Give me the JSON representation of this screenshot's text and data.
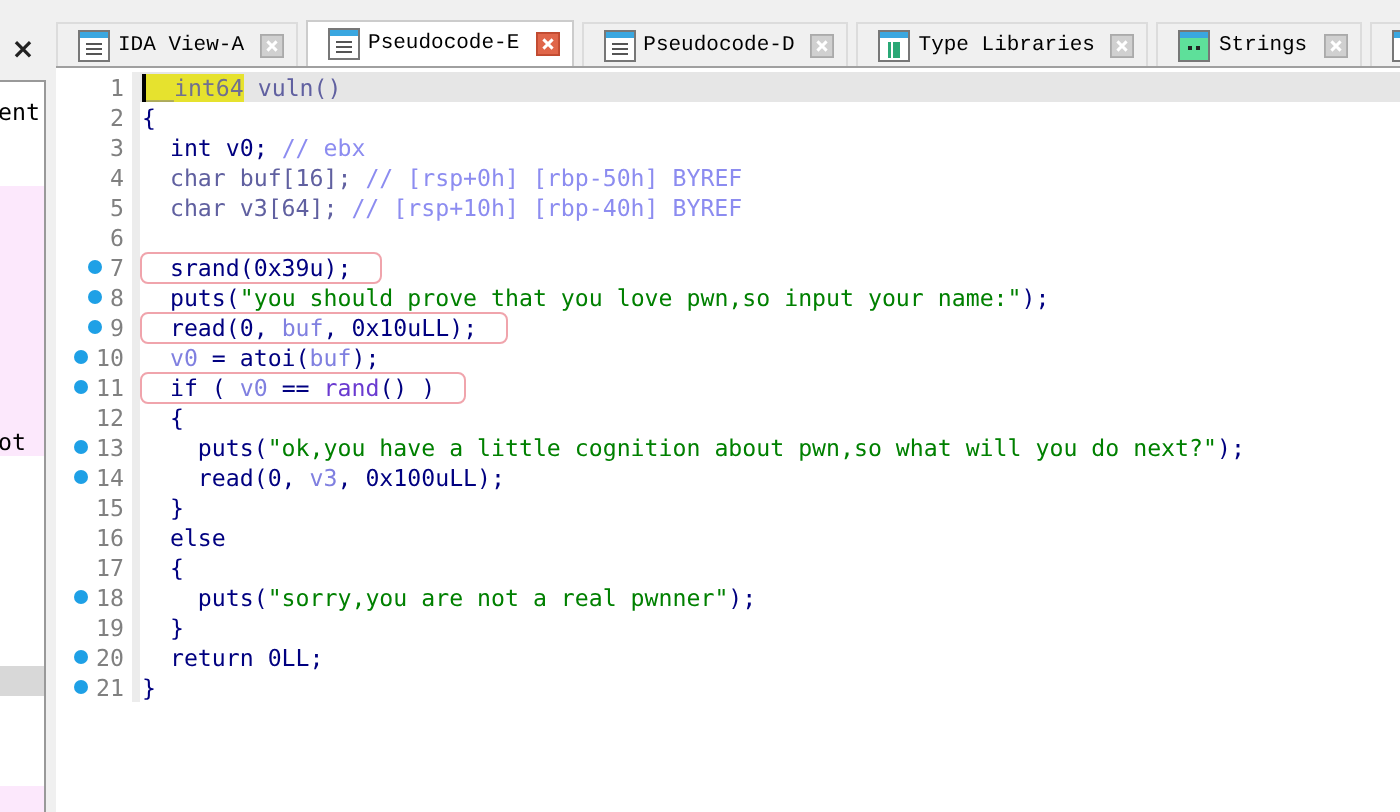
{
  "side_panel": {
    "close": "×",
    "rows": [
      {
        "kind": "row",
        "label": "ent",
        "marked": false,
        "selected": false
      },
      {
        "kind": "blank"
      },
      {
        "kind": "blank"
      },
      {
        "kind": "row",
        "marked": true,
        "selected": false
      },
      {
        "kind": "row",
        "marked": true,
        "selected": false
      },
      {
        "kind": "row",
        "marked": true,
        "selected": false
      },
      {
        "kind": "row",
        "marked": true,
        "selected": false
      },
      {
        "kind": "row",
        "marked": true,
        "selected": false
      },
      {
        "kind": "row",
        "marked": true,
        "selected": false
      },
      {
        "kind": "row",
        "marked": true,
        "selected": false
      },
      {
        "kind": "row",
        "marked": true,
        "selected": false
      },
      {
        "kind": "row",
        "label": "ot",
        "marked": true,
        "selected": false
      },
      {
        "kind": "blank"
      },
      {
        "kind": "blank"
      },
      {
        "kind": "blank"
      },
      {
        "kind": "blank"
      },
      {
        "kind": "blank"
      },
      {
        "kind": "blank"
      },
      {
        "kind": "blank"
      },
      {
        "kind": "row",
        "marked": false,
        "selected": true
      },
      {
        "kind": "blank"
      },
      {
        "kind": "blank"
      },
      {
        "kind": "blank"
      },
      {
        "kind": "row",
        "marked": true,
        "selected": false
      }
    ]
  },
  "tabs": [
    {
      "label": "IDA View-A",
      "kind": "listing",
      "selected": false
    },
    {
      "label": "Pseudocode-E",
      "kind": "listing",
      "selected": true
    },
    {
      "label": "Pseudocode-D",
      "kind": "listing",
      "selected": false
    },
    {
      "label": "Type Libraries",
      "kind": "types",
      "selected": false
    },
    {
      "label": "Strings",
      "kind": "strings",
      "selected": false
    },
    {
      "kind": "listing",
      "selected": false
    }
  ],
  "code_lines": [
    {
      "number": "1",
      "breakpoint": false,
      "current": true,
      "boxed": false,
      "tokens": [
        {
          "kind": "cursor",
          "text": "__int64"
        },
        {
          "kind": "dim",
          "text": " vuln()"
        }
      ]
    },
    {
      "number": "2",
      "breakpoint": false,
      "current": false,
      "boxed": false,
      "tokens": [
        {
          "kind": "code",
          "text": "{"
        }
      ]
    },
    {
      "number": "3",
      "breakpoint": false,
      "current": false,
      "boxed": false,
      "tokens": [
        {
          "kind": "code",
          "text": "  int v0; "
        },
        {
          "kind": "comment",
          "text": "// ebx"
        }
      ]
    },
    {
      "number": "4",
      "breakpoint": false,
      "current": false,
      "boxed": false,
      "tokens": [
        {
          "kind": "dim",
          "text": "  char buf[16]; "
        },
        {
          "kind": "comment",
          "text": "// [rsp+0h] [rbp-50h] BYREF"
        }
      ]
    },
    {
      "number": "5",
      "breakpoint": false,
      "current": false,
      "boxed": false,
      "tokens": [
        {
          "kind": "dim",
          "text": "  char v3[64]; "
        },
        {
          "kind": "comment",
          "text": "// [rsp+10h] [rbp-40h] BYREF"
        }
      ]
    },
    {
      "number": "6",
      "breakpoint": false
    },
    {
      "number": "7",
      "breakpoint": true,
      "current": false,
      "boxed": true,
      "tokens": [
        {
          "kind": "code",
          "text": "  srand(0x39u);"
        }
      ]
    },
    {
      "number": "8",
      "breakpoint": true,
      "current": false,
      "boxed": false,
      "tokens": [
        {
          "kind": "code",
          "text": "  puts("
        },
        {
          "kind": "string",
          "text": "\"you should prove that you love pwn,so input your name:\""
        },
        {
          "kind": "code",
          "text": ");"
        }
      ]
    },
    {
      "number": "9",
      "breakpoint": true,
      "current": false,
      "boxed": true,
      "tokens": [
        {
          "kind": "code",
          "text": "  read(0, "
        },
        {
          "kind": "var",
          "text": "buf"
        },
        {
          "kind": "code",
          "text": ", 0x10uLL);"
        }
      ]
    },
    {
      "number": "10",
      "breakpoint": true,
      "current": false,
      "boxed": false,
      "tokens": [
        {
          "kind": "var",
          "text": "  v0"
        },
        {
          "kind": "code",
          "text": " = atoi("
        },
        {
          "kind": "var",
          "text": "buf"
        },
        {
          "kind": "code",
          "text": ");"
        }
      ]
    },
    {
      "number": "11",
      "breakpoint": true,
      "current": false,
      "boxed": true,
      "tokens": [
        {
          "kind": "code",
          "text": "  if ( "
        },
        {
          "kind": "var",
          "text": "v0"
        },
        {
          "kind": "code",
          "text": " == "
        },
        {
          "kind": "call",
          "text": "rand"
        },
        {
          "kind": "code",
          "text": "() )"
        }
      ]
    },
    {
      "number": "12",
      "breakpoint": false,
      "current": false,
      "boxed": false,
      "tokens": [
        {
          "kind": "code",
          "text": "  {"
        }
      ]
    },
    {
      "number": "13",
      "breakpoint": true,
      "current": false,
      "boxed": false,
      "tokens": [
        {
          "kind": "code",
          "text": "    puts("
        },
        {
          "kind": "string",
          "text": "\"ok,you have a little cognition about pwn,so what will you do next?\""
        },
        {
          "kind": "code",
          "text": ");"
        }
      ]
    },
    {
      "number": "14",
      "breakpoint": true,
      "current": false,
      "boxed": false,
      "tokens": [
        {
          "kind": "code",
          "text": "    read(0, "
        },
        {
          "kind": "var",
          "text": "v3"
        },
        {
          "kind": "code",
          "text": ", 0x100uLL);"
        }
      ]
    },
    {
      "number": "15",
      "breakpoint": false,
      "current": false,
      "boxed": false,
      "tokens": [
        {
          "kind": "code",
          "text": "  }"
        }
      ]
    },
    {
      "number": "16",
      "breakpoint": false,
      "current": false,
      "boxed": false,
      "tokens": [
        {
          "kind": "code",
          "text": "  else"
        }
      ]
    },
    {
      "number": "17",
      "breakpoint": false,
      "current": false,
      "boxed": false,
      "tokens": [
        {
          "kind": "code",
          "text": "  {"
        }
      ]
    },
    {
      "number": "18",
      "breakpoint": true,
      "current": false,
      "boxed": false,
      "tokens": [
        {
          "kind": "code",
          "text": "    puts("
        },
        {
          "kind": "string",
          "text": "\"sorry,you are not a real pwnner\""
        },
        {
          "kind": "code",
          "text": ");"
        }
      ]
    },
    {
      "number": "19",
      "breakpoint": false,
      "current": false,
      "boxed": false,
      "tokens": [
        {
          "kind": "code",
          "text": "  }"
        }
      ]
    },
    {
      "number": "20",
      "breakpoint": true,
      "current": false,
      "boxed": false,
      "tokens": [
        {
          "kind": "code",
          "text": "  return 0LL;"
        }
      ]
    },
    {
      "number": "21",
      "breakpoint": true,
      "current": false,
      "boxed": false,
      "tokens": [
        {
          "kind": "code",
          "text": "}"
        }
      ]
    }
  ]
}
